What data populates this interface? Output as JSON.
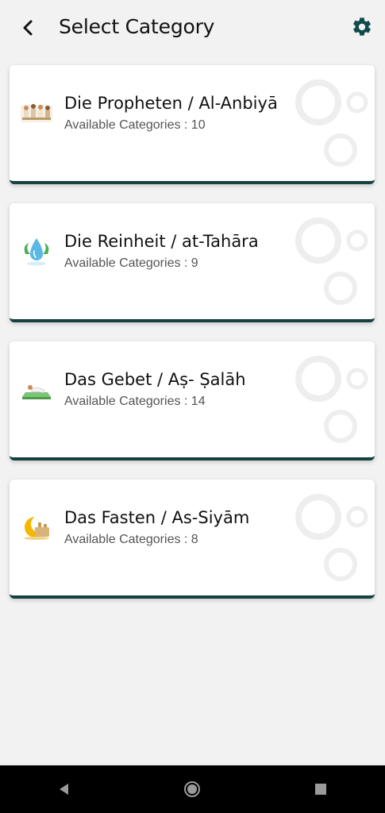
{
  "header": {
    "title": "Select Category",
    "back_icon": "back-arrow-icon",
    "settings_icon": "gear-icon"
  },
  "colors": {
    "background": "#f2f2f2",
    "card": "#ffffff",
    "accent": "#17403f",
    "settings_icon": "#0f4b4b"
  },
  "categories": [
    {
      "title": "Die Propheten / Al-Anbiyā",
      "subtitle": "Available Categories : 10",
      "icon": "prophets-icon"
    },
    {
      "title": "Die Reinheit / at-Tahāra",
      "subtitle": "Available Categories : 9",
      "icon": "water-drop-icon"
    },
    {
      "title": "Das Gebet / Aṣ- Ṣalāh",
      "subtitle": "Available Categories : 14",
      "icon": "prayer-mat-icon"
    },
    {
      "title": "Das Fasten / As-Siyām",
      "subtitle": "Available Categories : 8",
      "icon": "crescent-moon-icon"
    }
  ],
  "nav": {
    "back_icon": "nav-back-icon",
    "home_icon": "nav-home-icon",
    "recents_icon": "nav-recents-icon"
  }
}
